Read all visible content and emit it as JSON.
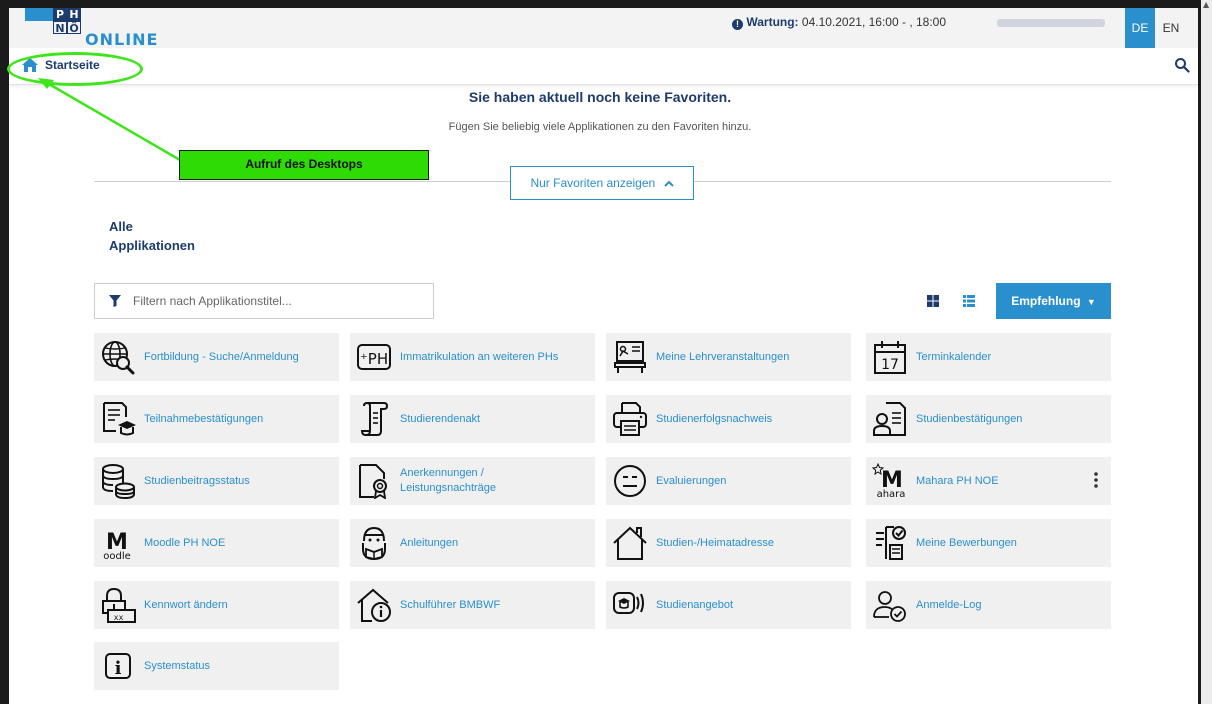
{
  "header": {
    "logo_top": [
      "P",
      "H"
    ],
    "logo_bottom": [
      "N",
      "Ö"
    ],
    "logo_online": "ONLINE",
    "maintenance_label": "Wartung:",
    "maintenance_text": " 04.10.2021, 16:00 - , 18:00",
    "languages": [
      "DE",
      "EN"
    ],
    "active_language": "DE"
  },
  "breadcrumb": {
    "home_label": "Startseite"
  },
  "annotation": {
    "label": "Aufruf des Desktops",
    "color": "#3ee51a"
  },
  "favorites": {
    "title": "Sie haben aktuell noch keine Favoriten.",
    "subtitle": "Fügen Sie beliebig viele Applikationen zu den Favoriten hinzu.",
    "toggle_label": "Nur Favoriten anzeigen"
  },
  "apps": {
    "heading_line1": "Alle",
    "heading_line2": "Applikationen",
    "filter_placeholder": "Filtern nach Applikationstitel...",
    "sort_label": "Empfehlung",
    "tiles": [
      {
        "label": "Fortbildung - Suche/Anmeldung",
        "icon": "globe-search-icon"
      },
      {
        "label": "Immatrikulation an weiteren PHs",
        "icon": "plus-ph-icon"
      },
      {
        "label": "Meine Lehrveranstaltungen",
        "icon": "lecture-board-icon"
      },
      {
        "label": "Terminkalender",
        "icon": "calendar-icon",
        "icon_text": "17"
      },
      {
        "label": "Teilnahmebestätigungen",
        "icon": "certificate-graduation-icon"
      },
      {
        "label": "Studierendenakt",
        "icon": "scroll-file-icon"
      },
      {
        "label": "Studienerfolgsnachweis",
        "icon": "printer-icon"
      },
      {
        "label": "Studienbestätigungen",
        "icon": "id-card-icon"
      },
      {
        "label": "Studienbeitragsstatus",
        "icon": "coins-icon"
      },
      {
        "label": "Anerkennungen / Leistungsnachträge",
        "icon": "document-badge-icon"
      },
      {
        "label": "Evaluierungen",
        "icon": "neutral-face-icon"
      },
      {
        "label": "Mahara PH NOE",
        "icon": "mahara-icon",
        "icon_text": "ahara"
      },
      {
        "label": "Moodle PH NOE",
        "icon": "moodle-icon",
        "icon_text": "oodle"
      },
      {
        "label": "Anleitungen",
        "icon": "reading-person-icon"
      },
      {
        "label": "Studien-/Heimatadresse",
        "icon": "house-icon"
      },
      {
        "label": "Meine Bewerbungen",
        "icon": "application-hand-icon"
      },
      {
        "label": "Kennwort ändern",
        "icon": "password-lock-icon",
        "icon_text": "xx_"
      },
      {
        "label": "Schulführer BMBWF",
        "icon": "school-info-icon"
      },
      {
        "label": "Studienangebot",
        "icon": "broadcast-graduation-icon"
      },
      {
        "label": "Anmelde-Log",
        "icon": "user-check-icon"
      },
      {
        "label": "Systemstatus",
        "icon": "info-box-icon",
        "icon_text": "i"
      }
    ]
  }
}
